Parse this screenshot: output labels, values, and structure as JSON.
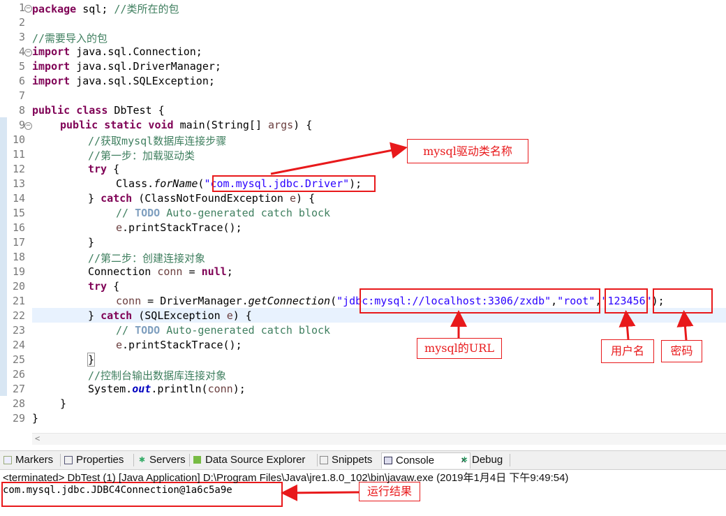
{
  "line_numbers": [
    "1",
    "2",
    "3",
    "4",
    "5",
    "6",
    "7",
    "8",
    "9",
    "10",
    "11",
    "12",
    "13",
    "14",
    "15",
    "16",
    "17",
    "18",
    "19",
    "20",
    "21",
    "22",
    "23",
    "24",
    "25",
    "26",
    "27",
    "28",
    "29"
  ],
  "code": {
    "l1_kw": "package",
    "l1_rest": " sql; ",
    "l1_cm": "//类所在的包",
    "l3_cm": "//需要导入的包",
    "import_kw": "import",
    "l4_rest": " java.sql.Connection;",
    "l5_rest": " java.sql.DriverManager;",
    "l6_rest": " java.sql.SQLException;",
    "l8_kw": "public class",
    "l8_rest": " DbTest {",
    "l9_kw": "public static void",
    "l9_a": " main(String[] ",
    "l9_args": "args",
    "l9_b": ") {",
    "l10_cm": "//获取mysql数据库连接步骤",
    "l11_cm": "//第一步：加载驱动类",
    "try_kw": "try",
    "brace_open": " {",
    "l13_a": "Class.",
    "l13_method": "forName",
    "l13_b": "(",
    "l13_str": "\"com.mysql.jdbc.Driver\"",
    "l13_c": ");",
    "catch_pre": "} ",
    "catch_kw": "catch",
    "l14_a": " (ClassNotFoundException ",
    "e_var": "e",
    "catch_close": ") {",
    "todo_pre": "// ",
    "todo_kw": "TODO",
    "todo_rest": " Auto-generated catch block",
    "print_stack": ".printStackTrace();",
    "close_brace": "}",
    "l18_cm": "//第二步：创建连接对象",
    "l19_a": "Connection ",
    "l19_conn": "conn",
    "l19_b": " = ",
    "null_kw": "null",
    "l19_c": ";",
    "l21_a": " = DriverManager.",
    "l21_method": "getConnection",
    "l21_b": "(",
    "l21_url": "\"jdbc:mysql://localhost:3306/zxdb\"",
    "comma": ",",
    "l21_user": "\"root\"",
    "l21_pwd": "\"123456\"",
    "l21_end": ");",
    "l22_a": " (SQLException ",
    "l26_cm": "//控制台输出数据库连接对象",
    "l27_a": "System.",
    "l27_out": "out",
    "l27_b": ".println(",
    "l27_c": ");"
  },
  "annotations": {
    "driver": "mysql驱动类名称",
    "url": "mysql的URL",
    "user": "用户名",
    "password": "密码",
    "result": "运行结果"
  },
  "scrollbar_glyph": "<",
  "panel_tabs": [
    {
      "label": "Markers",
      "icon": "markers-icon"
    },
    {
      "label": "Properties",
      "icon": "properties-icon"
    },
    {
      "label": "Servers",
      "icon": "servers-icon"
    },
    {
      "label": "Data Source Explorer",
      "icon": "data-source-icon"
    },
    {
      "label": "Snippets",
      "icon": "snippets-icon"
    },
    {
      "label": "Console",
      "icon": "console-icon",
      "close": "✕"
    },
    {
      "label": "Debug",
      "icon": "debug-icon"
    }
  ],
  "console": {
    "status": "<terminated> DbTest (1) [Java Application] D:\\Program Files\\Java\\jre1.8.0_102\\bin\\javaw.exe (2019年1月4日 下午9:49:54)",
    "output": "com.mysql.jdbc.JDBC4Connection@1a6c5a9e"
  },
  "colors": {
    "keyword": "#7f0055",
    "comment": "#3f7f5f",
    "string": "#2a00ff",
    "annotation_red": "#e8191b",
    "current_line": "#e8f2fe"
  }
}
